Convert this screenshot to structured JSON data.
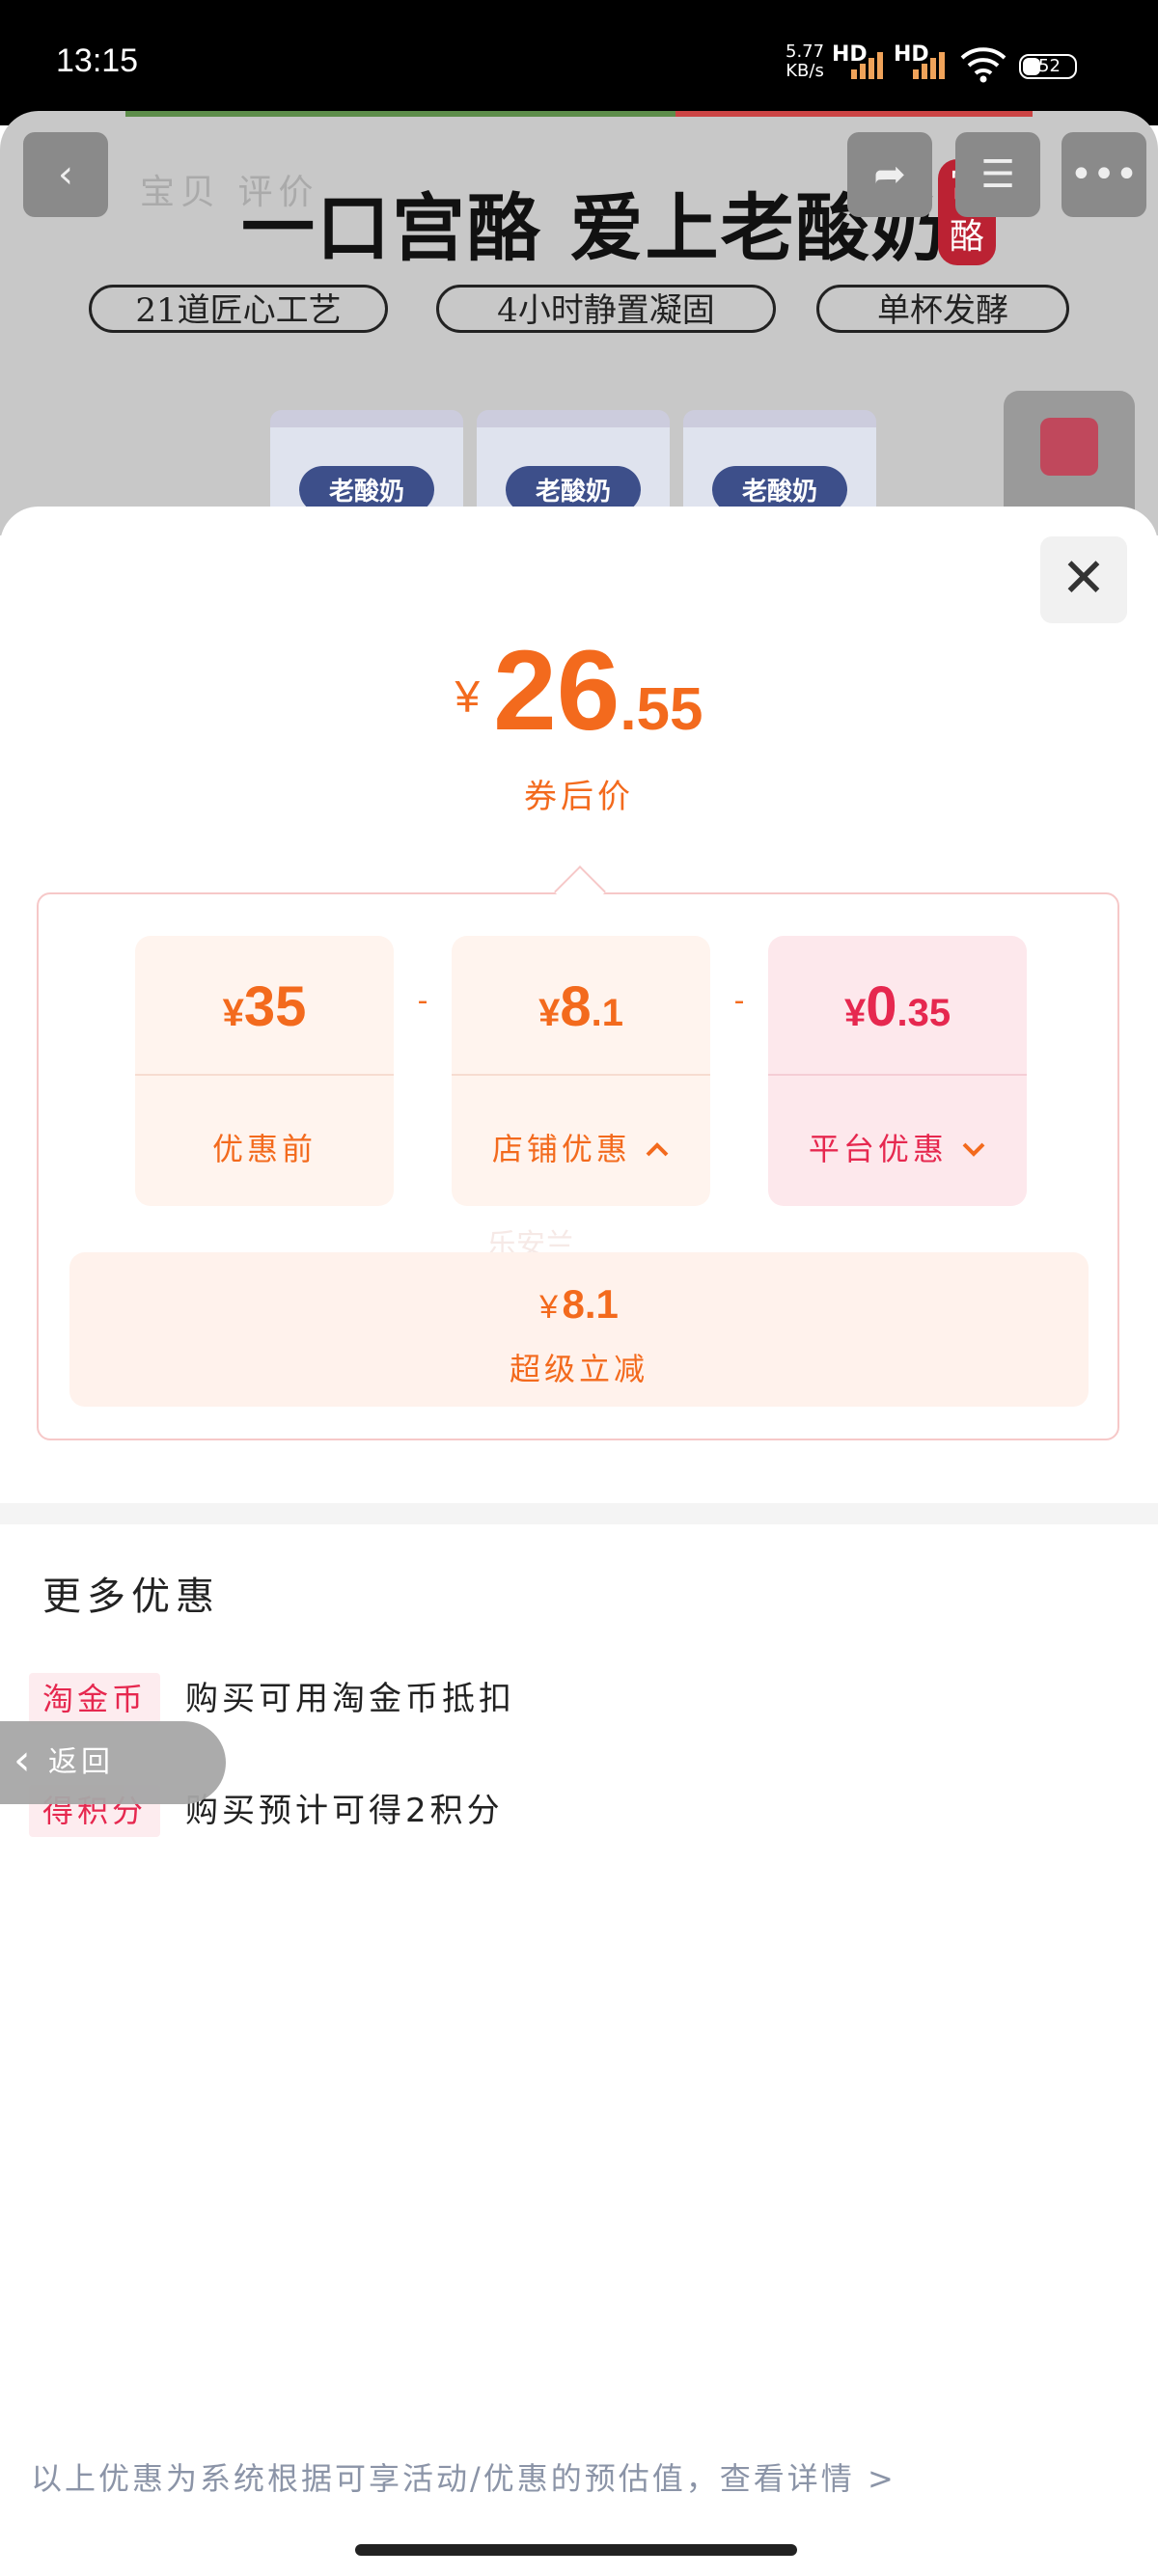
{
  "status_bar": {
    "time": "13:15",
    "net_speed": "5.77",
    "net_unit": "KB/s",
    "hd1": "HD",
    "hd2": "HD",
    "battery": "52"
  },
  "background_page": {
    "tabs": "宝贝  评价",
    "headline": "一口宫酪 爱上老酸奶",
    "features": [
      "21道匠心工艺",
      "4小时静置凝固",
      "单杯发酵"
    ],
    "seal_text": "宫酪",
    "cup_label": "老酸奶",
    "back_icon": "chevron-left-icon",
    "share_icon": "share-icon",
    "cart_icon": "cart-icon",
    "more_icon": "more-dots-icon"
  },
  "sheet": {
    "close_icon": "close-icon",
    "price": {
      "currency": "¥",
      "integer": "26",
      "decimal": ".55",
      "label": "券后价"
    },
    "breakdown": [
      {
        "currency": "¥",
        "integer": "35",
        "decimal": "",
        "label": "优惠前",
        "chevron": ""
      },
      {
        "currency": "¥",
        "integer": "8",
        "decimal": ".1",
        "label": "店铺优惠",
        "chevron": "up"
      },
      {
        "currency": "¥",
        "integer": "0",
        "decimal": ".35",
        "label": "平台优惠",
        "chevron": "down"
      }
    ],
    "operator_minus": "-",
    "reduction": {
      "currency": "¥",
      "value": "8.1",
      "label": "超级立减"
    },
    "watermark": "乐安兰",
    "more_title": "更多优惠",
    "more_items": [
      {
        "tag": "淘金币",
        "text": "购买可用淘金币抵扣"
      },
      {
        "tag": "得积分",
        "text": "购买预计可得2积分"
      }
    ],
    "footer_note": "以上优惠为系统根据可享活动/优惠的预估值，查看详情 >"
  },
  "back_pill": {
    "label": "返回"
  },
  "colors": {
    "accent_orange": "#f36a1d",
    "accent_red": "#e6284f",
    "panel_border": "#f6c8c8"
  }
}
